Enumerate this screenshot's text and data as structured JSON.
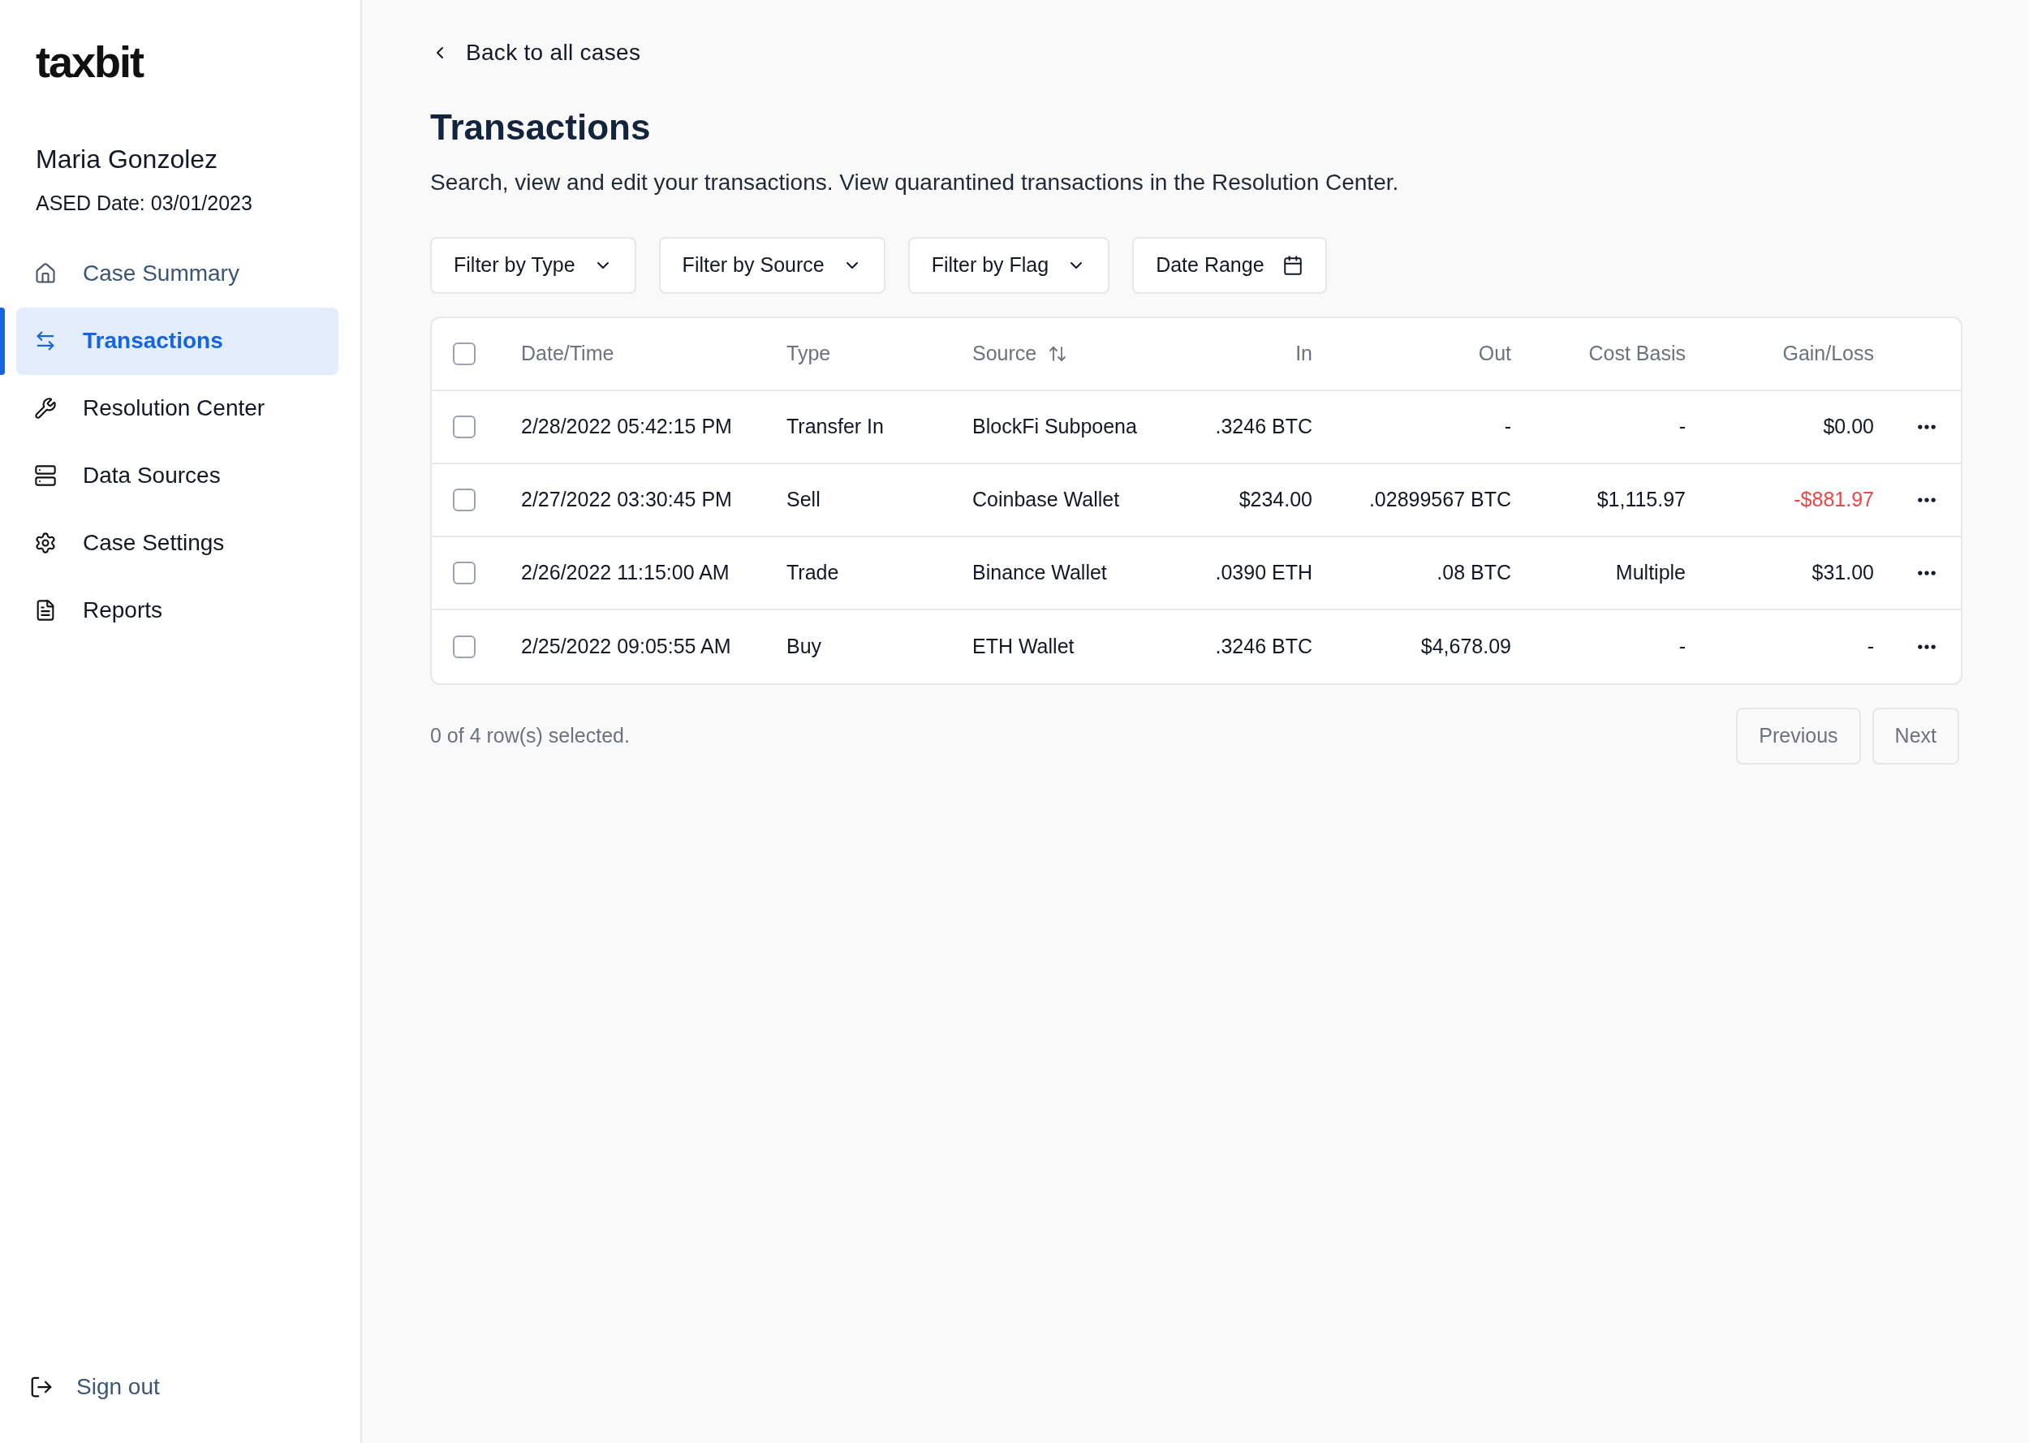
{
  "logo": "taxbit",
  "user": {
    "name": "Maria Gonzolez",
    "ased_date": "ASED Date: 03/01/2023"
  },
  "nav": [
    {
      "label": "Case Summary",
      "selected": false,
      "muted": true
    },
    {
      "label": "Transactions",
      "selected": true,
      "muted": false
    },
    {
      "label": "Resolution Center",
      "selected": false,
      "muted": false
    },
    {
      "label": "Data Sources",
      "selected": false,
      "muted": false
    },
    {
      "label": "Case Settings",
      "selected": false,
      "muted": false
    },
    {
      "label": "Reports",
      "selected": false,
      "muted": false
    }
  ],
  "sign_out": "Sign out",
  "back_link": "Back to all cases",
  "title": "Transactions",
  "subtitle": "Search, view and edit your transactions. View quarantined transactions in the Resolution Center.",
  "filters": [
    {
      "label": "Filter by Type",
      "kind": "dropdown"
    },
    {
      "label": "Filter by Source",
      "kind": "dropdown"
    },
    {
      "label": "Filter by Flag",
      "kind": "dropdown"
    },
    {
      "label": "Date Range",
      "kind": "date"
    }
  ],
  "table": {
    "select_all_checked": false,
    "columns": [
      {
        "label": "Date/Time",
        "sortable": false
      },
      {
        "label": "Type",
        "sortable": false
      },
      {
        "label": "Source",
        "sortable": true
      },
      {
        "label": "In",
        "sortable": false
      },
      {
        "label": "Out",
        "sortable": false
      },
      {
        "label": "Cost Basis",
        "sortable": false
      },
      {
        "label": "Gain/Loss",
        "sortable": false
      }
    ],
    "rows": [
      {
        "checked": false,
        "loss": false,
        "cells": [
          "2/28/2022 05:42:15 PM",
          "Transfer In",
          "BlockFi Subpoena",
          ".3246 BTC",
          "-",
          "-",
          "$0.00"
        ]
      },
      {
        "checked": false,
        "loss": true,
        "cells": [
          "2/27/2022 03:30:45 PM",
          "Sell",
          "Coinbase Wallet",
          "$234.00",
          ".02899567 BTC",
          "$1,115.97",
          "-$881.97"
        ]
      },
      {
        "checked": false,
        "loss": false,
        "cells": [
          "2/26/2022 11:15:00 AM",
          "Trade",
          "Binance Wallet",
          ".0390 ETH",
          ".08 BTC",
          "Multiple",
          "$31.00"
        ]
      },
      {
        "checked": false,
        "loss": false,
        "cells": [
          "2/25/2022 09:05:55 AM",
          "Buy",
          "ETH Wallet",
          ".3246 BTC",
          "$4,678.09",
          "-",
          "-"
        ]
      }
    ]
  },
  "selection_status": "0 of 4 row(s) selected.",
  "pagination": [
    {
      "label": "Previous",
      "disabled": true
    },
    {
      "label": "Next",
      "disabled": true
    }
  ]
}
